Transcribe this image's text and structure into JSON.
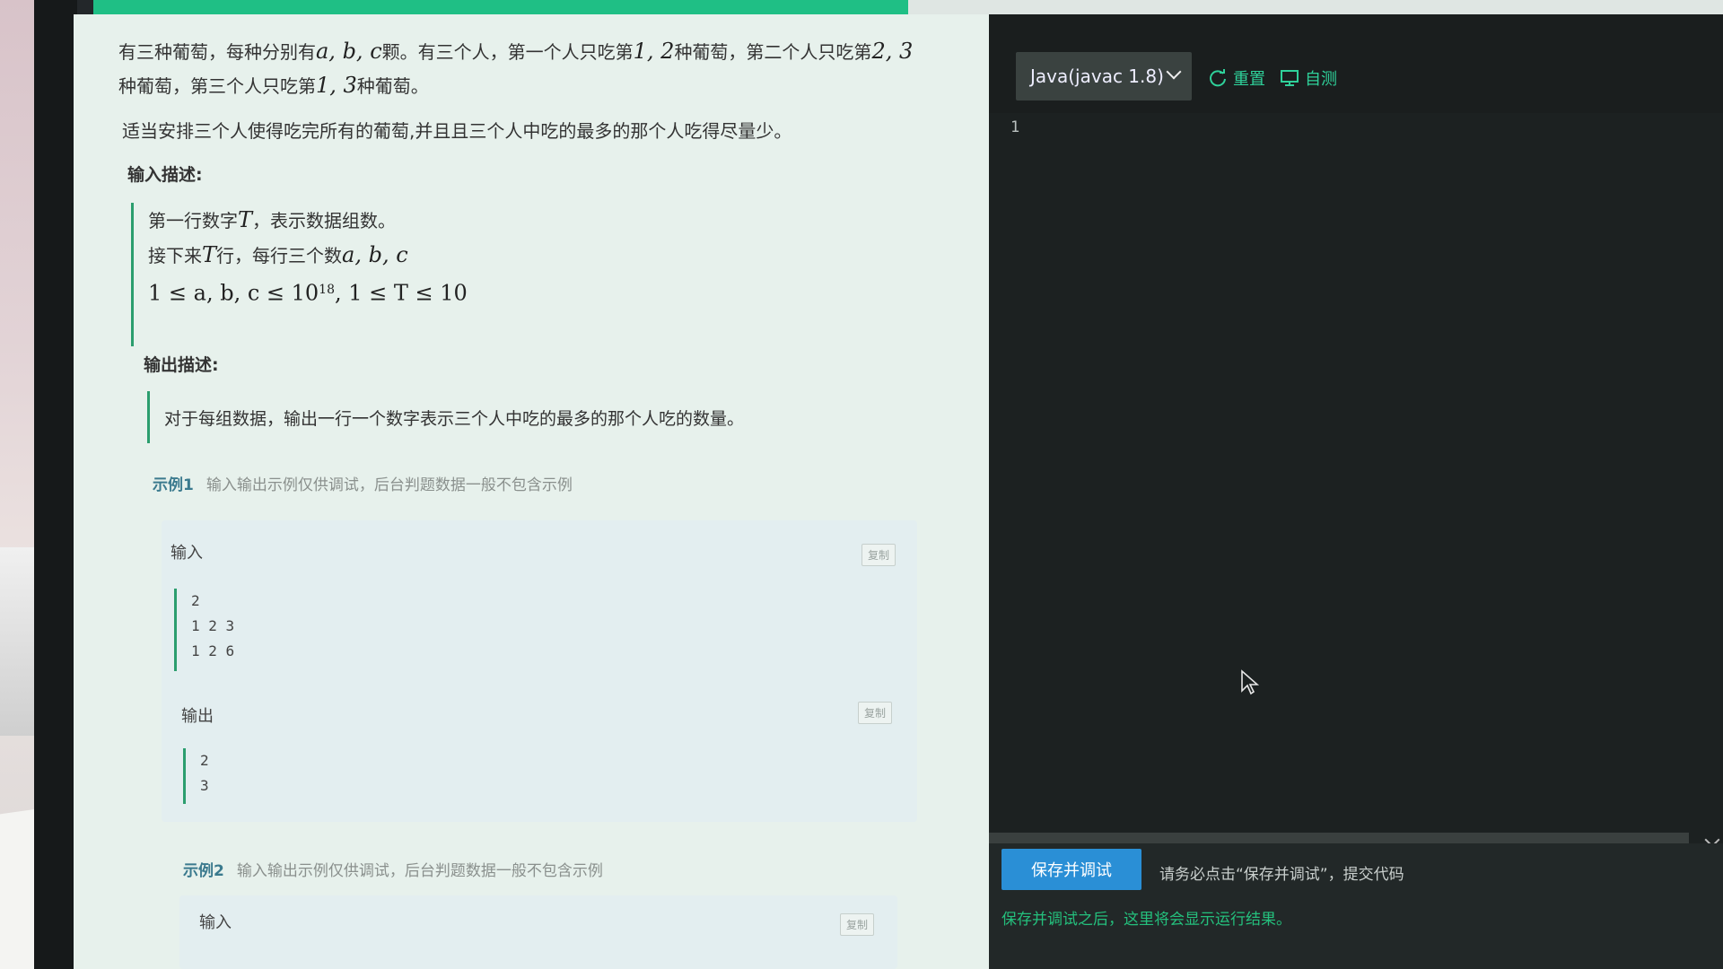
{
  "progress": {
    "fraction": 0.5
  },
  "problem": {
    "desc_line1_prefix": "有三种葡萄，每种分别有",
    "desc_line1_math1": "a, b, c",
    "desc_line1_mid": "颗。有三个人，第一个人只吃第",
    "desc_line1_math2": "1, 2",
    "desc_line1_mid2": "种葡萄，第二个人只吃第",
    "desc_line1_math3": "2, 3",
    "desc_line2_prefix": "种葡萄，第三个人只吃第",
    "desc_line2_math": "1, 3",
    "desc_line2_suffix": "种葡萄。",
    "desc_line3": "适当安排三个人使得吃完所有的葡萄,并且且三个人中吃的最多的那个人吃得尽量少。"
  },
  "input_section": {
    "title": "输入描述:",
    "line1_prefix": "第一行数字",
    "line1_math": "T",
    "line1_suffix": "，表示数据组数。",
    "line2_prefix": "接下来",
    "line2_math": "T",
    "line2_mid": "行，每行三个数",
    "line2_math2": "a, b, c",
    "constraint_a": "1 ≤ a, b, c ≤ 10",
    "constraint_exp": "18",
    "constraint_b": ", 1 ≤ T ≤ 10"
  },
  "output_section": {
    "title": "输出描述:",
    "line1": "对于每组数据，输出一行一个数字表示三个人中吃的最多的那个人吃的数量。"
  },
  "example1": {
    "title": "示例1",
    "note": "输入输出示例仅供调试，后台判题数据一般不包含示例",
    "input_label": "输入",
    "copy_label": "复制",
    "input_lines": [
      "2",
      "1  2  3",
      "1  2  6"
    ],
    "output_label": "输出",
    "output_lines": [
      "2",
      "3"
    ]
  },
  "example2": {
    "title": "示例2",
    "note": "输入输出示例仅供调试，后台判题数据一般不包含示例",
    "input_label": "输入",
    "copy_label": "复制"
  },
  "editor": {
    "language": "Java(javac 1.8)",
    "reset_label": "重置",
    "selftest_label": "自测",
    "line_number": "1",
    "run_button": "保存并调试",
    "run_hint": "请务必点击“保存并调试”，提交代码",
    "result_message": "保存并调试之后，这里将会显示运行结果。"
  },
  "colors": {
    "accent": "#1fbf85",
    "panel_bg": "#e7f1ec",
    "editor_bg": "#1c2121",
    "run_button": "#2a8fd6"
  }
}
